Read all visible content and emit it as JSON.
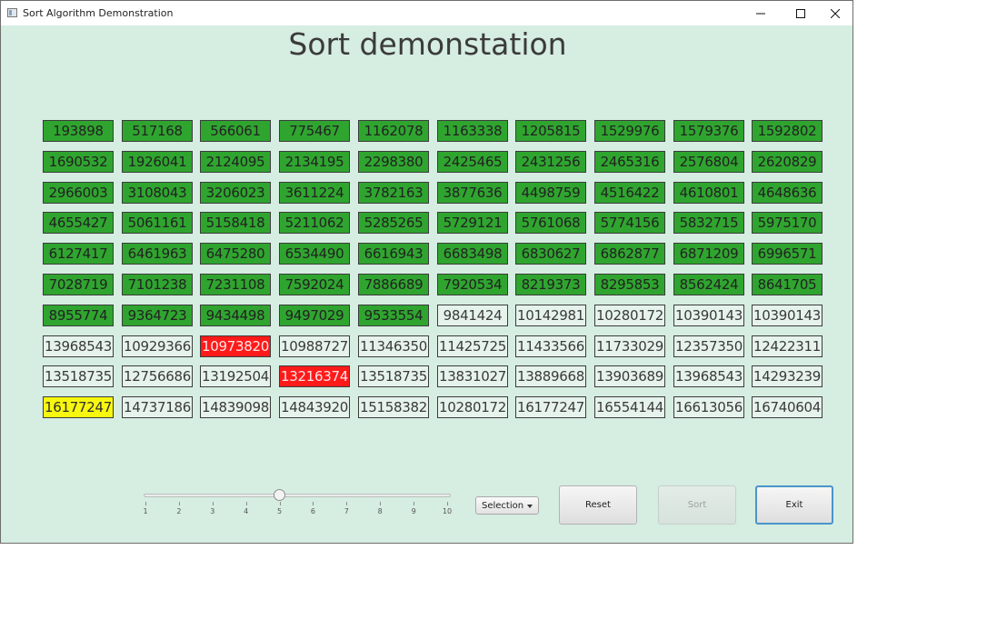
{
  "window": {
    "title": "Sort Algorithm Demonstration",
    "controls": [
      "minimize",
      "maximize",
      "close"
    ]
  },
  "heading": "Sort demonstation",
  "grid": {
    "rows": [
      [
        {
          "v": "193898",
          "s": "green"
        },
        {
          "v": "517168",
          "s": "green"
        },
        {
          "v": "566061",
          "s": "green"
        },
        {
          "v": "775467",
          "s": "green"
        },
        {
          "v": "1162078",
          "s": "green"
        },
        {
          "v": "1163338",
          "s": "green"
        },
        {
          "v": "1205815",
          "s": "green"
        },
        {
          "v": "1529976",
          "s": "green"
        },
        {
          "v": "1579376",
          "s": "green"
        },
        {
          "v": "1592802",
          "s": "green"
        }
      ],
      [
        {
          "v": "1690532",
          "s": "green"
        },
        {
          "v": "1926041",
          "s": "green"
        },
        {
          "v": "2124095",
          "s": "green"
        },
        {
          "v": "2134195",
          "s": "green"
        },
        {
          "v": "2298380",
          "s": "green"
        },
        {
          "v": "2425465",
          "s": "green"
        },
        {
          "v": "2431256",
          "s": "green"
        },
        {
          "v": "2465316",
          "s": "green"
        },
        {
          "v": "2576804",
          "s": "green"
        },
        {
          "v": "2620829",
          "s": "green"
        }
      ],
      [
        {
          "v": "2966003",
          "s": "green"
        },
        {
          "v": "3108043",
          "s": "green"
        },
        {
          "v": "3206023",
          "s": "green"
        },
        {
          "v": "3611224",
          "s": "green"
        },
        {
          "v": "3782163",
          "s": "green"
        },
        {
          "v": "3877636",
          "s": "green"
        },
        {
          "v": "4498759",
          "s": "green"
        },
        {
          "v": "4516422",
          "s": "green"
        },
        {
          "v": "4610801",
          "s": "green"
        },
        {
          "v": "4648636",
          "s": "green"
        }
      ],
      [
        {
          "v": "4655427",
          "s": "green"
        },
        {
          "v": "5061161",
          "s": "green"
        },
        {
          "v": "5158418",
          "s": "green"
        },
        {
          "v": "5211062",
          "s": "green"
        },
        {
          "v": "5285265",
          "s": "green"
        },
        {
          "v": "5729121",
          "s": "green"
        },
        {
          "v": "5761068",
          "s": "green"
        },
        {
          "v": "5774156",
          "s": "green"
        },
        {
          "v": "5832715",
          "s": "green"
        },
        {
          "v": "5975170",
          "s": "green"
        }
      ],
      [
        {
          "v": "6127417",
          "s": "green"
        },
        {
          "v": "6461963",
          "s": "green"
        },
        {
          "v": "6475280",
          "s": "green"
        },
        {
          "v": "6534490",
          "s": "green"
        },
        {
          "v": "6616943",
          "s": "green"
        },
        {
          "v": "6683498",
          "s": "green"
        },
        {
          "v": "6830627",
          "s": "green"
        },
        {
          "v": "6862877",
          "s": "green"
        },
        {
          "v": "6871209",
          "s": "green"
        },
        {
          "v": "6996571",
          "s": "green"
        }
      ],
      [
        {
          "v": "7028719",
          "s": "green"
        },
        {
          "v": "7101238",
          "s": "green"
        },
        {
          "v": "7231108",
          "s": "green"
        },
        {
          "v": "7592024",
          "s": "green"
        },
        {
          "v": "7886689",
          "s": "green"
        },
        {
          "v": "7920534",
          "s": "green"
        },
        {
          "v": "8219373",
          "s": "green"
        },
        {
          "v": "8295853",
          "s": "green"
        },
        {
          "v": "8562424",
          "s": "green"
        },
        {
          "v": "8641705",
          "s": "green"
        }
      ],
      [
        {
          "v": "8955774",
          "s": "green"
        },
        {
          "v": "9364723",
          "s": "green"
        },
        {
          "v": "9434498",
          "s": "green"
        },
        {
          "v": "9497029",
          "s": "green"
        },
        {
          "v": "9533554",
          "s": "green"
        },
        {
          "v": "9841424",
          "s": "normal"
        },
        {
          "v": "10142981",
          "s": "normal"
        },
        {
          "v": "10280172",
          "s": "normal"
        },
        {
          "v": "10390143",
          "s": "normal"
        },
        {
          "v": "10390143",
          "s": "normal"
        }
      ],
      [
        {
          "v": "13968543",
          "s": "normal"
        },
        {
          "v": "10929366",
          "s": "normal"
        },
        {
          "v": "10973820",
          "s": "red"
        },
        {
          "v": "10988727",
          "s": "normal"
        },
        {
          "v": "11346350",
          "s": "normal"
        },
        {
          "v": "11425725",
          "s": "normal"
        },
        {
          "v": "11433566",
          "s": "normal"
        },
        {
          "v": "11733029",
          "s": "normal"
        },
        {
          "v": "12357350",
          "s": "normal"
        },
        {
          "v": "12422311",
          "s": "normal"
        }
      ],
      [
        {
          "v": "13518735",
          "s": "normal"
        },
        {
          "v": "12756686",
          "s": "normal"
        },
        {
          "v": "13192504",
          "s": "normal"
        },
        {
          "v": "13216374",
          "s": "red"
        },
        {
          "v": "13518735",
          "s": "normal"
        },
        {
          "v": "13831027",
          "s": "normal"
        },
        {
          "v": "13889668",
          "s": "normal"
        },
        {
          "v": "13903689",
          "s": "normal"
        },
        {
          "v": "13968543",
          "s": "normal"
        },
        {
          "v": "14293239",
          "s": "normal"
        }
      ],
      [
        {
          "v": "16177247",
          "s": "yellow"
        },
        {
          "v": "14737186",
          "s": "normal"
        },
        {
          "v": "14839098",
          "s": "normal"
        },
        {
          "v": "14843920",
          "s": "normal"
        },
        {
          "v": "15158382",
          "s": "normal"
        },
        {
          "v": "10280172",
          "s": "normal"
        },
        {
          "v": "16177247",
          "s": "normal"
        },
        {
          "v": "16554144",
          "s": "normal"
        },
        {
          "v": "16613056",
          "s": "normal"
        },
        {
          "v": "16740604",
          "s": "normal"
        }
      ]
    ]
  },
  "colors": {
    "window_bg": "#d6ede1",
    "sorted": "#2fa52f",
    "normal": "#e6f3ec",
    "compare": "#ff1a1a",
    "current": "#f7f710"
  },
  "speed_slider": {
    "value": 5,
    "min": 1,
    "max": 10,
    "ticks": [
      "1",
      "2",
      "3",
      "4",
      "5",
      "6",
      "7",
      "8",
      "9",
      "10"
    ]
  },
  "algorithm_select": {
    "selected": "Selection"
  },
  "buttons": {
    "reset": "Reset",
    "sort": "Sort",
    "exit": "Exit"
  }
}
